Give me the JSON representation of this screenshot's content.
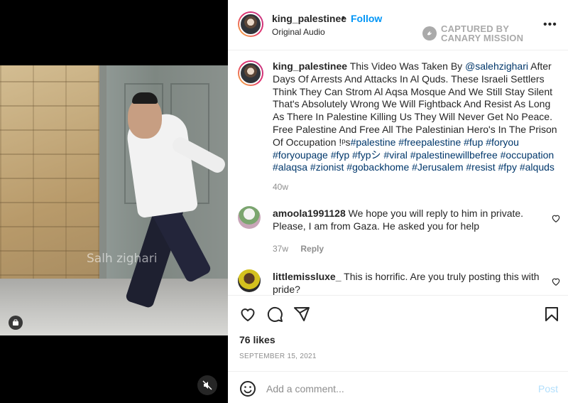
{
  "post": {
    "username": "king_palestinee",
    "dot": "•",
    "follow_label": "Follow",
    "audio": "Original Audio",
    "more": "•••"
  },
  "watermark": {
    "line1": "CAPTURED BY",
    "line2": "CANARY MISSION"
  },
  "video": {
    "overlay_text": "Salh zighari"
  },
  "caption": {
    "username": "king_palestinee",
    "text_before": "This Video Was Taken By ",
    "mention": "@salehzighari",
    "text_after": " After Days Of Arrests And Attacks In Al Quds. These Israeli Settlers Think They Can Strom Al Aqsa Mosque And We Still Stay Silent That's Absolutely Wrong We Will Fightback And Resist As Long As There In Palestine Killing Us They Will Never Get No Peace. Free Palestine And Free All The Palestinian Hero's In The Prison Of Occupation !ᵖs",
    "hashtags": "#palestine #freepalestine #fup #foryou #foryoupage #fyp #fypシ #viral #palestinewillbefree #occupation #alaqsa #zionist #gobackhome #Jerusalem #resist #fpy #alquds",
    "time": "40w"
  },
  "comments": [
    {
      "username": "amoola1991128",
      "text": "We hope you will reply to him in private. Please, I am from Gaza. He asked you for help",
      "time": "37w",
      "reply_label": "Reply"
    },
    {
      "username": "littlemissluxe_",
      "text": "This is horrific. Are you truly posting this with pride?"
    }
  ],
  "actions": {
    "likes": "76 likes",
    "date": "SEPTEMBER 15, 2021"
  },
  "composer": {
    "placeholder": "Add a comment...",
    "post_label": "Post"
  },
  "icons": [
    "heart-icon",
    "comment-icon",
    "share-icon",
    "bookmark-icon",
    "emoji-icon",
    "more-icon",
    "mute-icon",
    "media-badge-icon",
    "canary-logo-icon"
  ],
  "colors": {
    "link": "#0095f6",
    "hashtag": "#00376b",
    "muted": "#8e8e8e",
    "post_disabled": "#b2dffc"
  }
}
